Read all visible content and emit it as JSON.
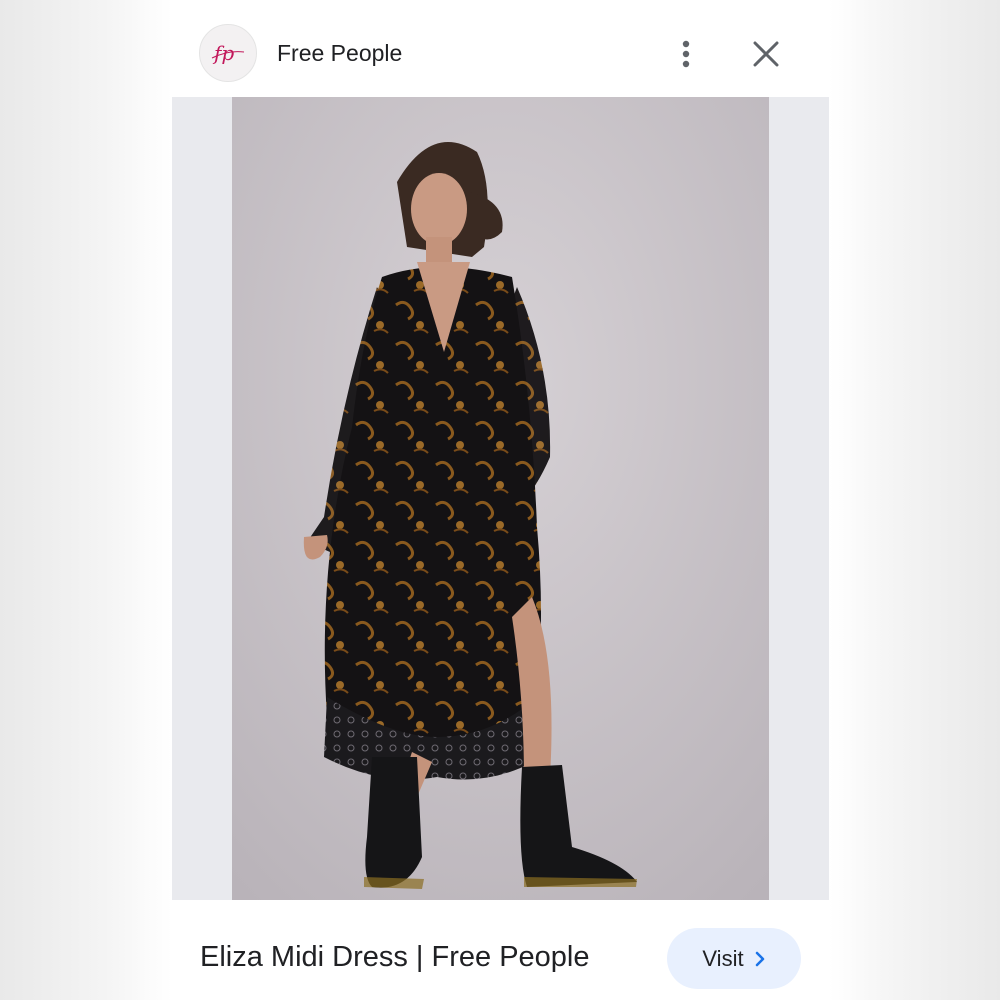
{
  "source": {
    "name": "Free People",
    "logo_text": "fp"
  },
  "header": {
    "more_icon": "more-vert-icon",
    "close_icon": "close-icon"
  },
  "image": {
    "alt": "Woman in black floral chiffon midi dress with lace hem and black lace-up boots"
  },
  "product": {
    "title": "Eliza Midi Dress | Free People"
  },
  "actions": {
    "visit_label": "Visit",
    "visit_icon": "chevron-right-icon"
  },
  "colors": {
    "accent": "#e8f0fe",
    "logo": "#c2185b",
    "text": "#202124"
  }
}
